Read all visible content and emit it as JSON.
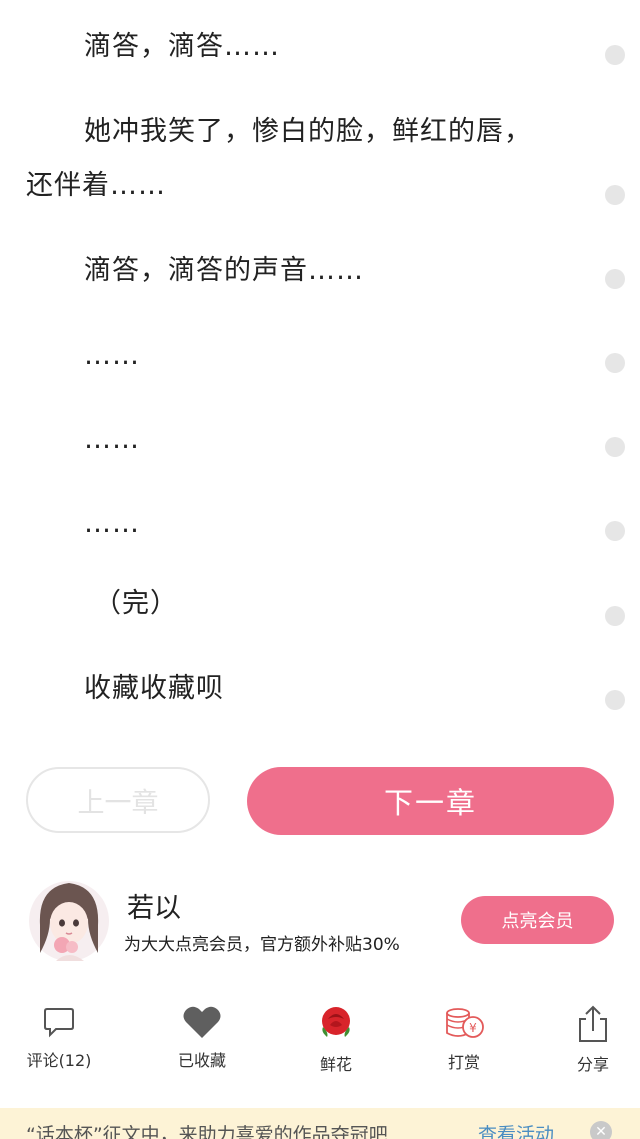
{
  "story": {
    "paragraphs": [
      "滴答，滴答……",
      "她冲我笑了，惨白的脸，鲜红的唇，还伴着……",
      "滴答，滴答的声音……",
      "……",
      "……",
      "……",
      "（完）",
      "收藏收藏呗"
    ]
  },
  "chapter_nav": {
    "prev_label": "上一章",
    "next_label": "下一章"
  },
  "author": {
    "name": "若以",
    "promo_text": "为大大点亮会员，官方额外补贴30%",
    "vip_button": "点亮会员"
  },
  "toolbar": {
    "items": [
      {
        "label": "评论(12)",
        "icon": "comment-icon"
      },
      {
        "label": "已收藏",
        "icon": "heart-icon"
      },
      {
        "label": "鲜花",
        "icon": "rose-icon"
      },
      {
        "label": "打赏",
        "icon": "coins-icon"
      },
      {
        "label": "分享",
        "icon": "share-icon"
      }
    ]
  },
  "banner": {
    "text": "“话本杯”征文中，来助力喜爱的作品夺冠吧",
    "link": "查看活动"
  },
  "colors": {
    "accent": "#ef6f8c",
    "banner_bg": "#fdf3d6",
    "link": "#4a8dc2"
  }
}
